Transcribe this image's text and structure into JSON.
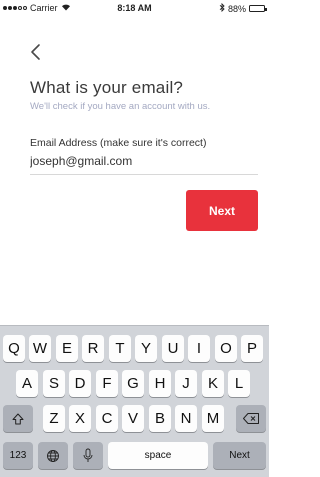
{
  "status_bar": {
    "carrier": "Carrier",
    "time": "8:18 AM",
    "battery": "88%",
    "battery_level": 0.88
  },
  "screen": {
    "back_icon": "chevron-left-icon",
    "title": "What is your email?",
    "subtitle": "We'll check if you have an account with us.",
    "field_label": "Email Address (make sure it's correct)",
    "field_value": "joseph@gmail.com",
    "next_label": "Next",
    "accent_color": "#e8323c"
  },
  "keyboard": {
    "row1": [
      "Q",
      "W",
      "E",
      "R",
      "T",
      "Y",
      "U",
      "I",
      "O",
      "P"
    ],
    "row2": [
      "A",
      "S",
      "D",
      "F",
      "G",
      "H",
      "J",
      "K",
      "L"
    ],
    "row3": [
      "Z",
      "X",
      "C",
      "V",
      "B",
      "N",
      "M"
    ],
    "numbers_label": "123",
    "space_label": "space",
    "return_label": "Next",
    "icons": [
      "shift-icon",
      "delete-icon",
      "globe-icon",
      "microphone-icon"
    ]
  }
}
